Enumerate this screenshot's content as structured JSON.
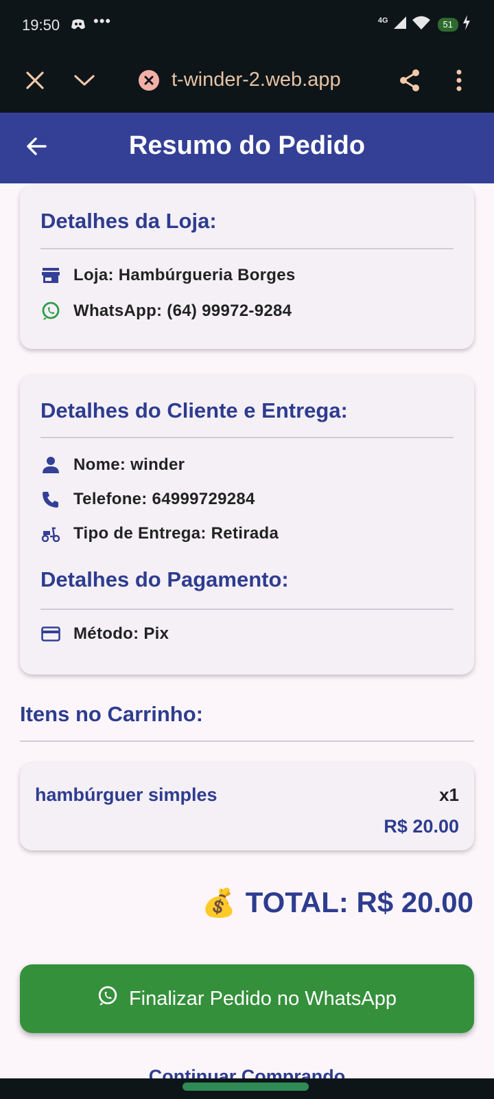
{
  "status_bar": {
    "time": "19:50",
    "network": "4G",
    "battery": "51",
    "dots": "•••"
  },
  "browser": {
    "url": "t-winder-2.web.app"
  },
  "app_bar": {
    "title": "Resumo do Pedido"
  },
  "store_card": {
    "heading": "Detalhes da Loja:",
    "store": "Loja: Hambúrgueria Borges",
    "whatsapp": "WhatsApp: (64) 99972-9284"
  },
  "client_card": {
    "heading": "Detalhes do Cliente e Entrega:",
    "name": "Nome: winder",
    "phone": "Telefone: 64999729284",
    "delivery": "Tipo de Entrega: Retirada",
    "payment_heading": "Detalhes do Pagamento:",
    "method": "Método: Pix"
  },
  "cart": {
    "heading": "Itens no Carrinho:",
    "items": [
      {
        "name": "hambúrguer simples",
        "qty": "x1",
        "price": "R$ 20.00"
      }
    ]
  },
  "total": {
    "emoji": "💰",
    "label": "TOTAL: R$ 20.00"
  },
  "actions": {
    "finish_label": "Finalizar Pedido no WhatsApp",
    "continue_label": "Continuar Comprando"
  },
  "colors": {
    "primary": "#344096",
    "text_accent": "#2e3c8f",
    "button_green": "#35903b",
    "whatsapp_icon": "#2e9c47"
  }
}
